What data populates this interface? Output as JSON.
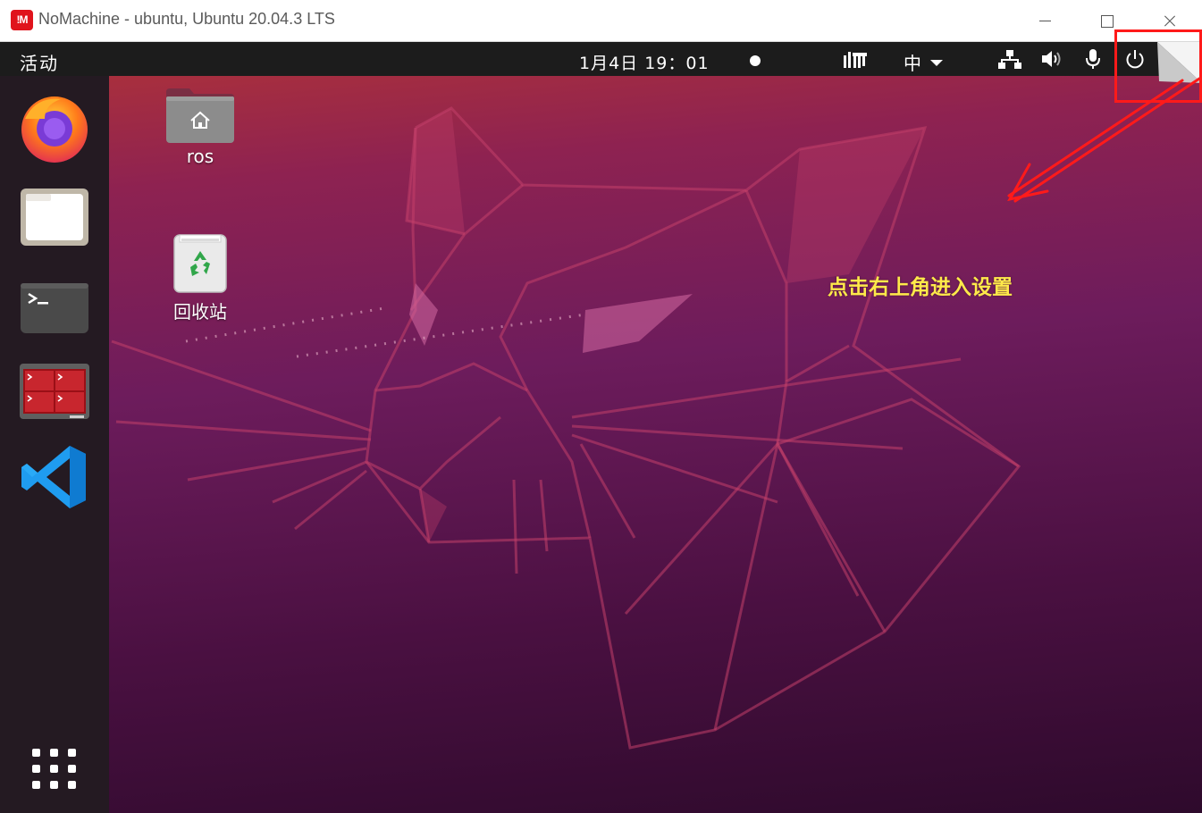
{
  "window": {
    "logo": "!M",
    "title": "NoMachine - ubuntu, Ubuntu 20.04.3 LTS",
    "controls": [
      "minimize-icon",
      "maximize-icon",
      "close-icon"
    ]
  },
  "topbar": {
    "activities": "活动",
    "clock": "1月4日  19：01",
    "input_method": "中",
    "indicators": [
      "notification-dot-icon",
      "input-meter-icon",
      "network-icon",
      "volume-icon",
      "microphone-icon",
      "power-icon"
    ]
  },
  "dock": {
    "apps": [
      "firefox-icon",
      "files-icon",
      "terminal-icon",
      "terminator-icon",
      "vscode-icon"
    ],
    "show_apps": "app-grid-icon"
  },
  "desktop": {
    "icons": [
      {
        "label": "ros",
        "icon": "home-folder-icon"
      },
      {
        "label": "回收站",
        "icon": "trash-icon"
      }
    ]
  },
  "annotation": {
    "text": "点击右上角进入设置",
    "color": "#ffe94a",
    "box_color": "#ff1a1a"
  },
  "colors": {
    "topbar": "#1c1c1c",
    "dock": "#241a22",
    "wallpaper_top": "#b23436",
    "wallpaper_bottom": "#2e0a2c"
  }
}
